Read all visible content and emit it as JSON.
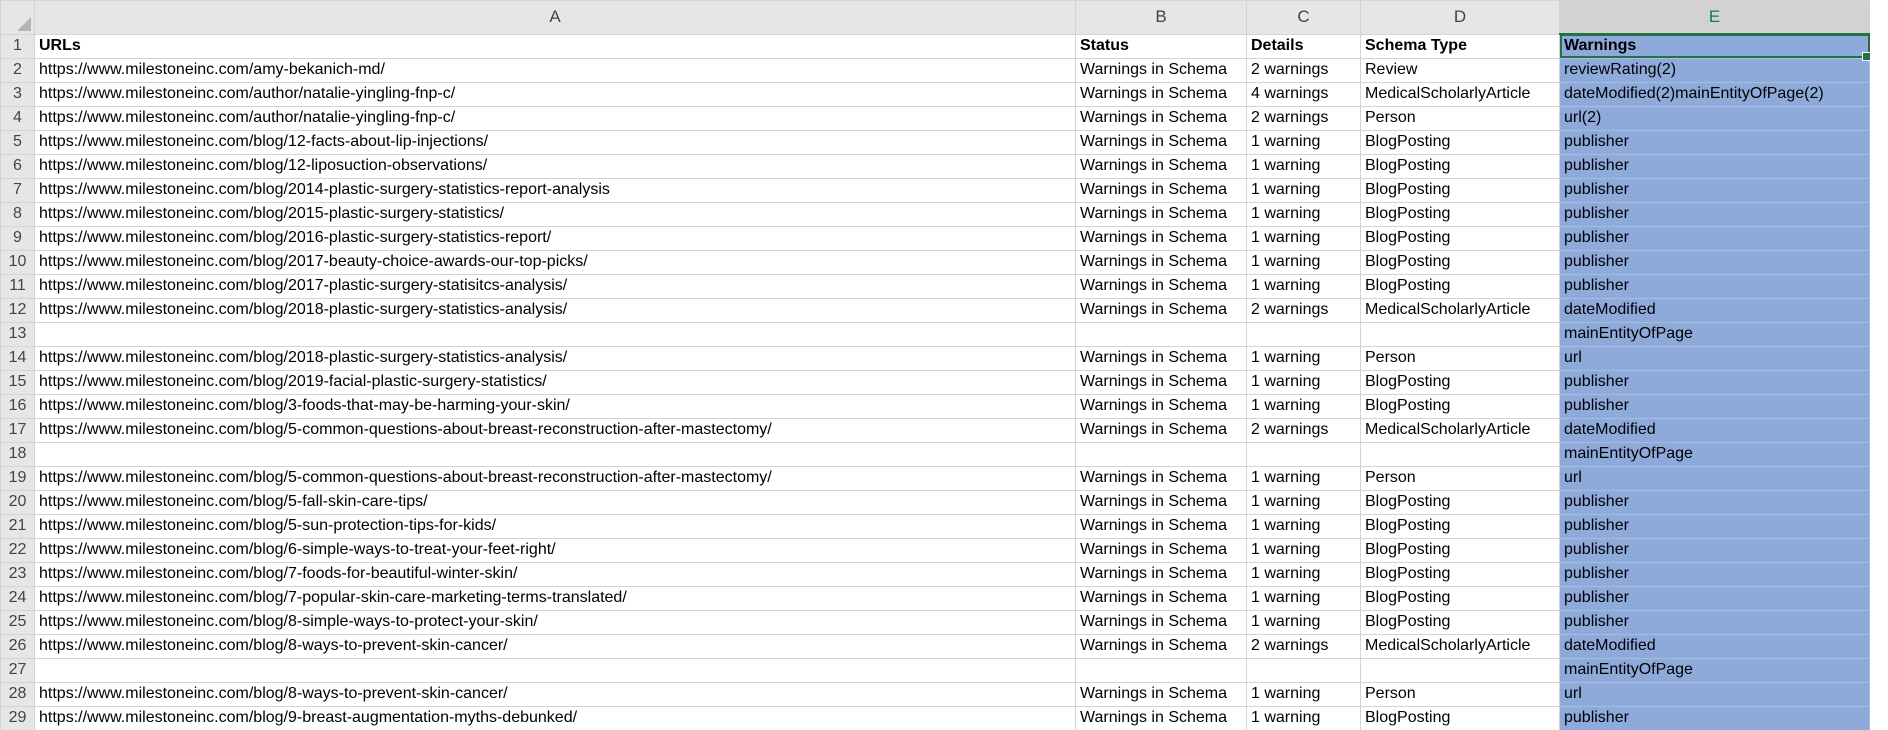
{
  "columns": [
    "A",
    "B",
    "C",
    "D",
    "E"
  ],
  "rows": [
    {
      "num": "1",
      "a": "URLs",
      "b": "Status",
      "c": "Details",
      "d": "Schema Type",
      "e": "Warnings"
    },
    {
      "num": "2",
      "a": "https://www.milestoneinc.com/amy-bekanich-md/",
      "b": "Warnings in Schema",
      "c": "2 warnings",
      "d": "Review",
      "e": "reviewRating(2)"
    },
    {
      "num": "3",
      "a": "https://www.milestoneinc.com/author/natalie-yingling-fnp-c/",
      "b": "Warnings in Schema",
      "c": "4 warnings",
      "d": "MedicalScholarlyArticle",
      "e": "dateModified(2)mainEntityOfPage(2)"
    },
    {
      "num": "4",
      "a": "https://www.milestoneinc.com/author/natalie-yingling-fnp-c/",
      "b": "Warnings in Schema",
      "c": "2 warnings",
      "d": "Person",
      "e": "url(2)"
    },
    {
      "num": "5",
      "a": "https://www.milestoneinc.com/blog/12-facts-about-lip-injections/",
      "b": "Warnings in Schema",
      "c": "1 warning",
      "d": "BlogPosting",
      "e": "publisher"
    },
    {
      "num": "6",
      "a": "https://www.milestoneinc.com/blog/12-liposuction-observations/",
      "b": "Warnings in Schema",
      "c": "1 warning",
      "d": "BlogPosting",
      "e": "publisher"
    },
    {
      "num": "7",
      "a": "https://www.milestoneinc.com/blog/2014-plastic-surgery-statistics-report-analysis",
      "b": "Warnings in Schema",
      "c": "1 warning",
      "d": "BlogPosting",
      "e": "publisher"
    },
    {
      "num": "8",
      "a": "https://www.milestoneinc.com/blog/2015-plastic-surgery-statistics/",
      "b": "Warnings in Schema",
      "c": "1 warning",
      "d": "BlogPosting",
      "e": "publisher"
    },
    {
      "num": "9",
      "a": "https://www.milestoneinc.com/blog/2016-plastic-surgery-statistics-report/",
      "b": "Warnings in Schema",
      "c": "1 warning",
      "d": "BlogPosting",
      "e": "publisher"
    },
    {
      "num": "10",
      "a": "https://www.milestoneinc.com/blog/2017-beauty-choice-awards-our-top-picks/",
      "b": "Warnings in Schema",
      "c": "1 warning",
      "d": "BlogPosting",
      "e": "publisher"
    },
    {
      "num": "11",
      "a": "https://www.milestoneinc.com/blog/2017-plastic-surgery-statisitcs-analysis/",
      "b": "Warnings in Schema",
      "c": "1 warning",
      "d": "BlogPosting",
      "e": "publisher"
    },
    {
      "num": "12",
      "a": "https://www.milestoneinc.com/blog/2018-plastic-surgery-statistics-analysis/",
      "b": "Warnings in Schema",
      "c": "2 warnings",
      "d": "MedicalScholarlyArticle",
      "e": "dateModified"
    },
    {
      "num": "13",
      "a": "",
      "b": "",
      "c": "",
      "d": "",
      "e": "mainEntityOfPage"
    },
    {
      "num": "14",
      "a": "https://www.milestoneinc.com/blog/2018-plastic-surgery-statistics-analysis/",
      "b": "Warnings in Schema",
      "c": "1 warning",
      "d": "Person",
      "e": "url"
    },
    {
      "num": "15",
      "a": "https://www.milestoneinc.com/blog/2019-facial-plastic-surgery-statistics/",
      "b": "Warnings in Schema",
      "c": "1 warning",
      "d": "BlogPosting",
      "e": "publisher"
    },
    {
      "num": "16",
      "a": "https://www.milestoneinc.com/blog/3-foods-that-may-be-harming-your-skin/",
      "b": "Warnings in Schema",
      "c": "1 warning",
      "d": "BlogPosting",
      "e": "publisher"
    },
    {
      "num": "17",
      "a": "https://www.milestoneinc.com/blog/5-common-questions-about-breast-reconstruction-after-mastectomy/",
      "b": "Warnings in Schema",
      "c": "2 warnings",
      "d": "MedicalScholarlyArticle",
      "e": "dateModified"
    },
    {
      "num": "18",
      "a": "",
      "b": "",
      "c": "",
      "d": "",
      "e": "mainEntityOfPage"
    },
    {
      "num": "19",
      "a": "https://www.milestoneinc.com/blog/5-common-questions-about-breast-reconstruction-after-mastectomy/",
      "b": "Warnings in Schema",
      "c": "1 warning",
      "d": "Person",
      "e": "url"
    },
    {
      "num": "20",
      "a": "https://www.milestoneinc.com/blog/5-fall-skin-care-tips/",
      "b": "Warnings in Schema",
      "c": "1 warning",
      "d": "BlogPosting",
      "e": "publisher"
    },
    {
      "num": "21",
      "a": "https://www.milestoneinc.com/blog/5-sun-protection-tips-for-kids/",
      "b": "Warnings in Schema",
      "c": "1 warning",
      "d": "BlogPosting",
      "e": "publisher"
    },
    {
      "num": "22",
      "a": "https://www.milestoneinc.com/blog/6-simple-ways-to-treat-your-feet-right/",
      "b": "Warnings in Schema",
      "c": "1 warning",
      "d": "BlogPosting",
      "e": "publisher"
    },
    {
      "num": "23",
      "a": "https://www.milestoneinc.com/blog/7-foods-for-beautiful-winter-skin/",
      "b": "Warnings in Schema",
      "c": "1 warning",
      "d": "BlogPosting",
      "e": "publisher"
    },
    {
      "num": "24",
      "a": "https://www.milestoneinc.com/blog/7-popular-skin-care-marketing-terms-translated/",
      "b": "Warnings in Schema",
      "c": "1 warning",
      "d": "BlogPosting",
      "e": "publisher"
    },
    {
      "num": "25",
      "a": "https://www.milestoneinc.com/blog/8-simple-ways-to-protect-your-skin/",
      "b": "Warnings in Schema",
      "c": "1 warning",
      "d": "BlogPosting",
      "e": "publisher"
    },
    {
      "num": "26",
      "a": "https://www.milestoneinc.com/blog/8-ways-to-prevent-skin-cancer/",
      "b": "Warnings in Schema",
      "c": "2 warnings",
      "d": "MedicalScholarlyArticle",
      "e": "dateModified"
    },
    {
      "num": "27",
      "a": "",
      "b": "",
      "c": "",
      "d": "",
      "e": "mainEntityOfPage"
    },
    {
      "num": "28",
      "a": "https://www.milestoneinc.com/blog/8-ways-to-prevent-skin-cancer/",
      "b": "Warnings in Schema",
      "c": "1 warning",
      "d": "Person",
      "e": "url"
    },
    {
      "num": "29",
      "a": "https://www.milestoneinc.com/blog/9-breast-augmentation-myths-debunked/",
      "b": "Warnings in Schema",
      "c": "1 warning",
      "d": "BlogPosting",
      "e": "publisher"
    }
  ],
  "colors": {
    "selected_column_fill": "#8eaadb",
    "header_fill": "#e6e6e6",
    "accent_green": "#217346"
  }
}
